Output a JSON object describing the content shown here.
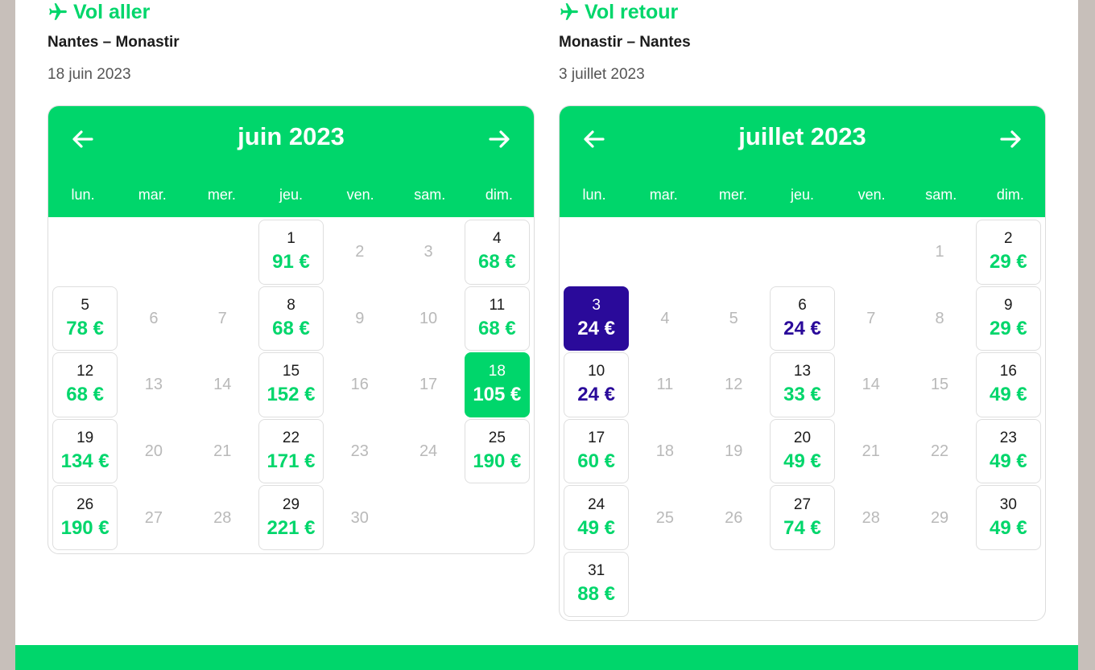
{
  "colors": {
    "accent": "#00d66b",
    "cheap": "#2a0a9a",
    "muted": "#b9b9b9"
  },
  "outbound": {
    "title": "Vol aller",
    "route": "Nantes – Monastir",
    "date": "18 juin 2023",
    "calendar": {
      "month": "juin 2023",
      "weekdays": [
        "lun.",
        "mar.",
        "mer.",
        "jeu.",
        "ven.",
        "sam.",
        "dim."
      ],
      "offset": 3,
      "days": [
        {
          "d": "1",
          "p": "91 €"
        },
        {
          "d": "2"
        },
        {
          "d": "3"
        },
        {
          "d": "4",
          "p": "68 €"
        },
        {
          "d": "5",
          "p": "78 €"
        },
        {
          "d": "6"
        },
        {
          "d": "7"
        },
        {
          "d": "8",
          "p": "68 €"
        },
        {
          "d": "9"
        },
        {
          "d": "10"
        },
        {
          "d": "11",
          "p": "68 €"
        },
        {
          "d": "12",
          "p": "68 €"
        },
        {
          "d": "13"
        },
        {
          "d": "14"
        },
        {
          "d": "15",
          "p": "152 €"
        },
        {
          "d": "16"
        },
        {
          "d": "17"
        },
        {
          "d": "18",
          "p": "105 €",
          "state": "selected"
        },
        {
          "d": "19",
          "p": "134 €"
        },
        {
          "d": "20"
        },
        {
          "d": "21"
        },
        {
          "d": "22",
          "p": "171 €"
        },
        {
          "d": "23"
        },
        {
          "d": "24"
        },
        {
          "d": "25",
          "p": "190 €"
        },
        {
          "d": "26",
          "p": "190 €"
        },
        {
          "d": "27"
        },
        {
          "d": "28"
        },
        {
          "d": "29",
          "p": "221 €"
        },
        {
          "d": "30"
        }
      ]
    }
  },
  "return": {
    "title": "Vol retour",
    "route": "Monastir – Nantes",
    "date": "3 juillet 2023",
    "calendar": {
      "month": "juillet 2023",
      "weekdays": [
        "lun.",
        "mar.",
        "mer.",
        "jeu.",
        "ven.",
        "sam.",
        "dim."
      ],
      "offset": 5,
      "days": [
        {
          "d": "1"
        },
        {
          "d": "2",
          "p": "29 €"
        },
        {
          "d": "3",
          "p": "24 €",
          "state": "selected"
        },
        {
          "d": "4"
        },
        {
          "d": "5"
        },
        {
          "d": "6",
          "p": "24 €",
          "cheap": true
        },
        {
          "d": "7"
        },
        {
          "d": "8"
        },
        {
          "d": "9",
          "p": "29 €"
        },
        {
          "d": "10",
          "p": "24 €",
          "cheap": true
        },
        {
          "d": "11"
        },
        {
          "d": "12"
        },
        {
          "d": "13",
          "p": "33 €"
        },
        {
          "d": "14"
        },
        {
          "d": "15"
        },
        {
          "d": "16",
          "p": "49 €"
        },
        {
          "d": "17",
          "p": "60 €"
        },
        {
          "d": "18"
        },
        {
          "d": "19"
        },
        {
          "d": "20",
          "p": "49 €"
        },
        {
          "d": "21"
        },
        {
          "d": "22"
        },
        {
          "d": "23",
          "p": "49 €"
        },
        {
          "d": "24",
          "p": "49 €"
        },
        {
          "d": "25"
        },
        {
          "d": "26"
        },
        {
          "d": "27",
          "p": "74 €"
        },
        {
          "d": "28"
        },
        {
          "d": "29"
        },
        {
          "d": "30",
          "p": "49 €"
        },
        {
          "d": "31",
          "p": "88 €"
        }
      ]
    }
  }
}
